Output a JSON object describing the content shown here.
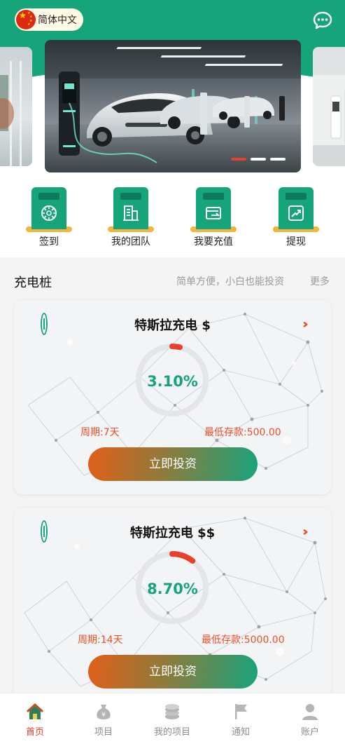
{
  "header": {
    "language_label": "简体中文",
    "flag_icon": "china-flag-icon",
    "chat_icon": "chat-bubble-icon",
    "brand_color": "#16a47b"
  },
  "banner": {
    "active_slide": 1,
    "slide_count": 3,
    "accent_color": "#e8402b"
  },
  "quick_actions": [
    {
      "label": "签到",
      "icon": "speedometer-icon"
    },
    {
      "label": "我的团队",
      "icon": "building-icon"
    },
    {
      "label": "我要充值",
      "icon": "wallet-icon"
    },
    {
      "label": "提现",
      "icon": "chart-up-icon"
    }
  ],
  "section": {
    "title": "充电桩",
    "subtitle": "简单方便，小白也能投资",
    "more": "更多"
  },
  "products": [
    {
      "title": "特斯拉充电 $",
      "rate": "3.10%",
      "rate_value": 3.1,
      "period": "周期:7天",
      "min_deposit": "最低存款:500.00",
      "button": "立即投资"
    },
    {
      "title": "特斯拉充电 $$",
      "rate": "8.70%",
      "rate_value": 8.7,
      "period": "周期:14天",
      "min_deposit": "最低存款:5000.00",
      "button": "立即投资"
    }
  ],
  "bottom_nav": [
    {
      "label": "首页",
      "icon": "home-icon",
      "active": true
    },
    {
      "label": "项目",
      "icon": "money-bag-icon",
      "active": false
    },
    {
      "label": "我的项目",
      "icon": "coin-stack-icon",
      "active": false
    },
    {
      "label": "通知",
      "icon": "flag-icon",
      "active": false
    },
    {
      "label": "账户",
      "icon": "user-icon",
      "active": false
    }
  ],
  "colors": {
    "brand": "#16a47b",
    "accent": "#e8502b",
    "gold": "#f6b43a"
  }
}
